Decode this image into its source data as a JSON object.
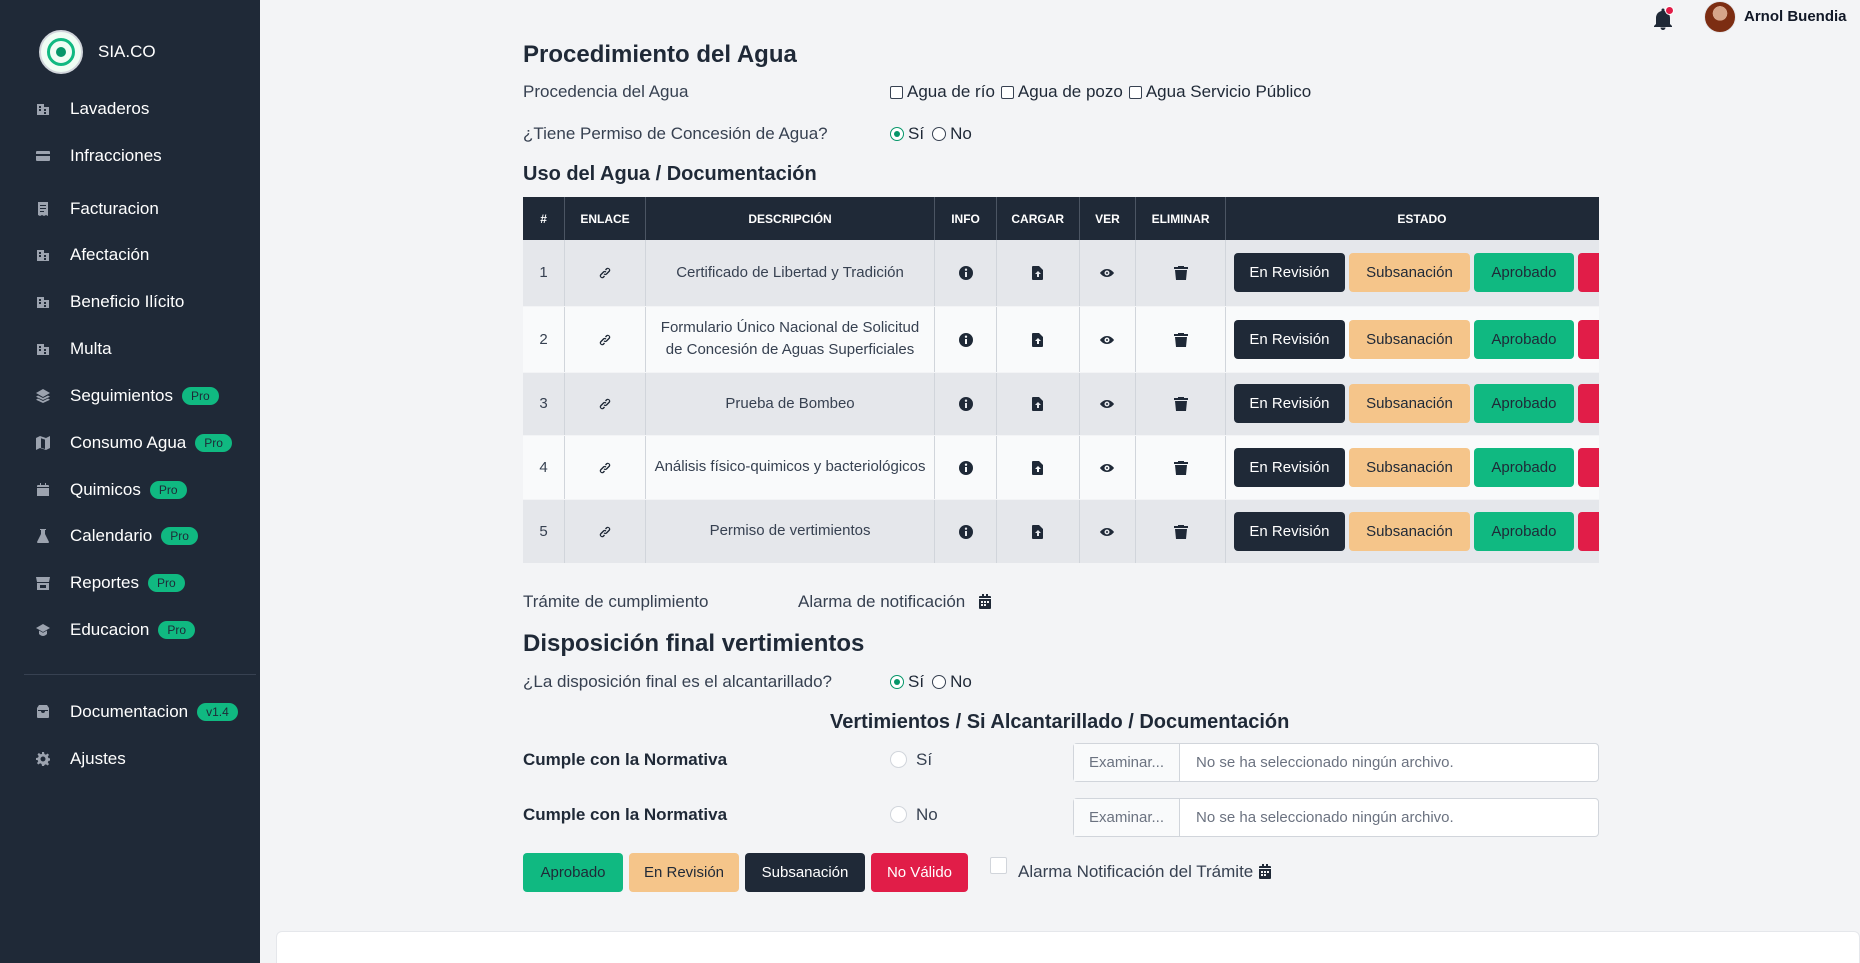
{
  "brand": {
    "name": "SIA.CO"
  },
  "sidebar": {
    "items": [
      {
        "label": "Lavaderos",
        "icon": "building-icon",
        "badge": ""
      },
      {
        "label": "Infracciones",
        "icon": "credit-card-icon",
        "badge": ""
      },
      {
        "label": "Facturacion",
        "icon": "receipt-icon",
        "badge": ""
      },
      {
        "label": "Afectación",
        "icon": "building-icon",
        "badge": ""
      },
      {
        "label": "Beneficio Ilícito",
        "icon": "building-icon",
        "badge": ""
      },
      {
        "label": "Multa",
        "icon": "building-icon",
        "badge": ""
      },
      {
        "label": "Seguimientos",
        "icon": "layers-icon",
        "badge": "Pro"
      },
      {
        "label": "Consumo Agua",
        "icon": "map-icon",
        "badge": "Pro"
      },
      {
        "label": "Quimicos",
        "icon": "calendar-icon",
        "badge": "Pro"
      },
      {
        "label": "Calendario",
        "icon": "flask-icon",
        "badge": "Pro"
      },
      {
        "label": "Reportes",
        "icon": "store-icon",
        "badge": "Pro"
      },
      {
        "label": "Educacion",
        "icon": "graduation-cap-icon",
        "badge": "Pro"
      }
    ],
    "bottom_items": [
      {
        "label": "Documentacion",
        "icon": "inbox-icon",
        "badge": "v1.4"
      },
      {
        "label": "Ajustes",
        "icon": "gear-icon",
        "badge": ""
      }
    ]
  },
  "topbar": {
    "user_name": "Arnol Buendia"
  },
  "section1": {
    "title": "Procedimiento del Agua",
    "procedencia_label": "Procedencia del Agua",
    "procedencia_options": [
      "Agua de río",
      "Agua de pozo",
      "Agua Servicio Público"
    ],
    "permiso_label": "¿Tiene Permiso de Concesión de Agua?",
    "permiso_options": {
      "yes": "Sí",
      "no": "No"
    }
  },
  "docs": {
    "title": "Uso del Agua / Documentación",
    "headers": [
      "#",
      "ENLACE",
      "DESCRIPCIÓN",
      "INFO",
      "CARGAR",
      "VER",
      "ELIMINAR",
      "ESTADO"
    ],
    "rows": [
      {
        "num": "1",
        "descripcion": "Certificado de Libertad y Tradición"
      },
      {
        "num": "2",
        "descripcion": "Formulario Único Nacional de Solicitud de Concesión de Aguas Superficiales"
      },
      {
        "num": "3",
        "descripcion": "Prueba de Bombeo"
      },
      {
        "num": "4",
        "descripcion": "Análisis físico-quimicos y bacteriológicos"
      },
      {
        "num": "5",
        "descripcion": "Permiso de vertimientos"
      }
    ],
    "estado_buttons": {
      "revision": "En Revisión",
      "subsanacion": "Subsanación",
      "aprobado": "Aprobado"
    }
  },
  "tramite": {
    "label": "Trámite de cumplimiento",
    "alarma": "Alarma de notificación"
  },
  "section2": {
    "title": "Disposición final vertimientos",
    "question": "¿La disposición final es el alcantarillado?",
    "options": {
      "yes": "Sí",
      "no": "No"
    },
    "subtitle": "Vertimientos / Si Alcantarillado / Documentación",
    "rows": [
      {
        "label": "Cumple con la Normativa",
        "option": "Sí",
        "file_button": "Examinar...",
        "file_text": "No se ha seleccionado ningún archivo."
      },
      {
        "label": "Cumple con la Normativa",
        "option": "No",
        "file_button": "Examinar...",
        "file_text": "No se ha seleccionado ningún archivo."
      }
    ],
    "buttons": {
      "aprobado": "Aprobado",
      "revision": "En Revisión",
      "subsanacion": "Subsanación",
      "no_valido": "No Válido"
    },
    "alarma_label": "Alarma Notificación del Trámite"
  },
  "colors": {
    "sidebar": "#1f2937",
    "accent": "#10b981",
    "warning": "#f5c58a",
    "danger": "#e11d48"
  }
}
